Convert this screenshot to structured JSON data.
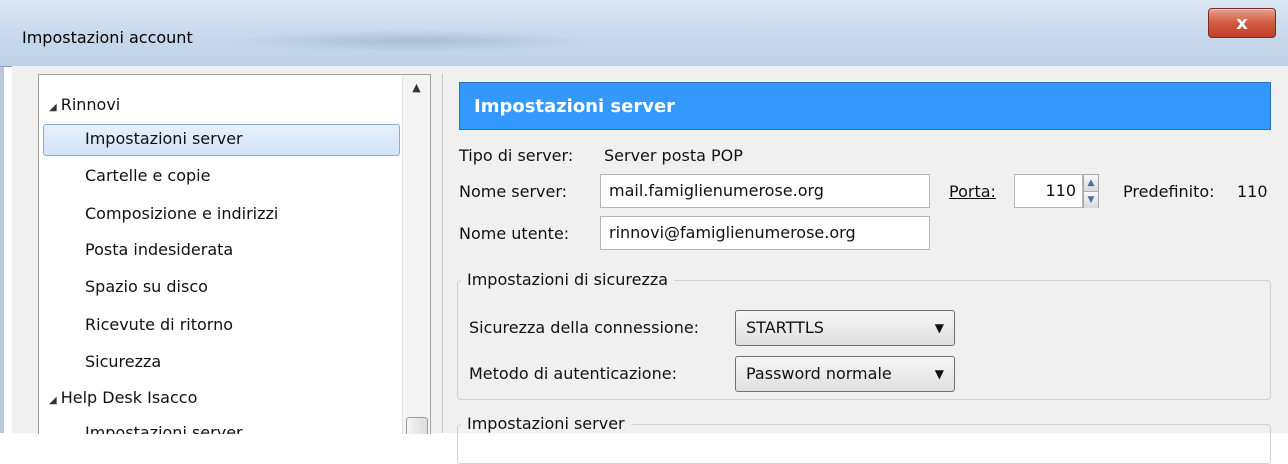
{
  "window": {
    "title": "Impostazioni account",
    "close_glyph": "x"
  },
  "tree": {
    "accounts": [
      {
        "name": "Rinnovi",
        "items": [
          "Impostazioni server",
          "Cartelle e copie",
          "Composizione e indirizzi",
          "Posta indesiderata",
          "Spazio su disco",
          "Ricevute di ritorno",
          "Sicurezza"
        ]
      },
      {
        "name": "Help Desk Isacco",
        "items": [
          "Impostazioni server"
        ]
      }
    ],
    "expand_glyph": "◢",
    "scroll_up_glyph": "▲",
    "selected": "Impostazioni server"
  },
  "panel": {
    "header": "Impostazioni server",
    "server_type_label": "Tipo di server:",
    "server_type_value": "Server posta POP",
    "server_name_label": "Nome server:",
    "server_name_value": "mail.famiglienumerose.org",
    "port_label": "Porta:",
    "port_value": "110",
    "default_label": "Predefinito:",
    "default_value": "110",
    "username_label": "Nome utente:",
    "username_value": "rinnovi@famiglienumerose.org",
    "security_group": {
      "title": "Impostazioni di sicurezza",
      "connection_label": "Sicurezza della connessione:",
      "connection_value": "STARTTLS",
      "auth_label": "Metodo di autenticazione:",
      "auth_value": "Password normale"
    },
    "server_group_title": "Impostazioni server"
  },
  "icons": {
    "spin_up": "▲",
    "spin_down": "▼",
    "dropdown": "▼"
  }
}
